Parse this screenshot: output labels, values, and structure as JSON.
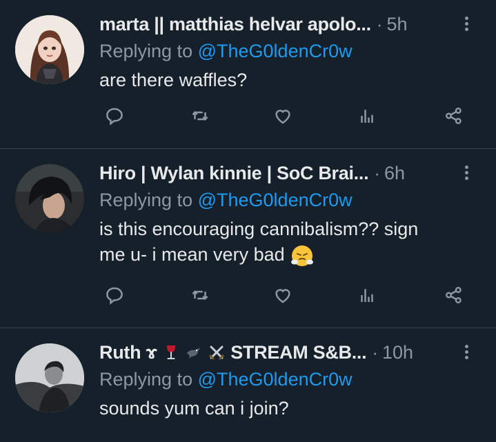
{
  "replies": [
    {
      "display_name": "marta || matthias helvar apolo...",
      "sep": "·",
      "time": "5h",
      "replying_prefix": "Replying to",
      "replying_handle": "@TheG0ldenCr0w",
      "text": "are there waffles?"
    },
    {
      "display_name": "Hiro | Wylan kinnie | SoC Brai...",
      "sep": "·",
      "time": "6h",
      "replying_prefix": "Replying to",
      "replying_handle": "@TheG0ldenCr0w",
      "text_line1": "is this encouraging cannibalism?? sign",
      "text_line2": "me u- i mean very bad"
    },
    {
      "display_name_prefix": "Ruth ɤ",
      "display_name_suffix": "STREAM S&B...",
      "sep": "·",
      "time": "10h",
      "replying_prefix": "Replying to",
      "replying_handle": "@TheG0ldenCr0w",
      "text": "sounds yum can i join?"
    }
  ],
  "icons": [
    "reply-icon",
    "retweet-icon",
    "like-icon",
    "views-icon",
    "share-icon",
    "more-icon"
  ],
  "colors": {
    "background": "#15202b",
    "text": "#e7e9ea",
    "muted": "#8b98a5",
    "link": "#1d9bf0",
    "divider": "#38444d"
  }
}
